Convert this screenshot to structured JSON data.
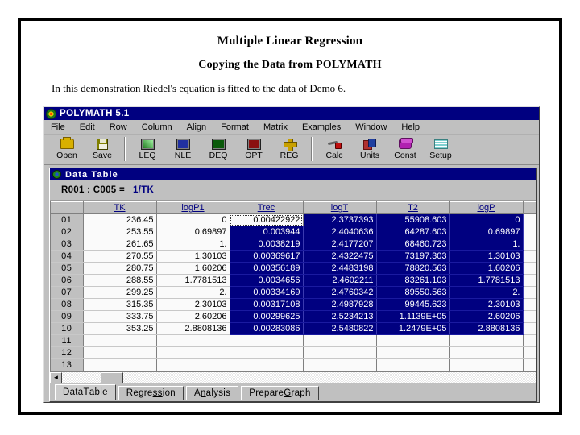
{
  "slide": {
    "heading_1": "Multiple Linear Regression",
    "heading_2": "Copying the Data from POLYMATH",
    "subtitle": "In this demonstration Riedel's equation is fitted to the data of Demo 6."
  },
  "app": {
    "title": "POLYMATH 5.1",
    "menu": [
      {
        "label": "File",
        "accel": "F"
      },
      {
        "label": "Edit",
        "accel": "E"
      },
      {
        "label": "Row",
        "accel": "R"
      },
      {
        "label": "Column",
        "accel": "C"
      },
      {
        "label": "Align",
        "accel": "A"
      },
      {
        "label": "Format",
        "accel": "a"
      },
      {
        "label": "Matrix",
        "accel": "x"
      },
      {
        "label": "Examples",
        "accel": "x"
      },
      {
        "label": "Window",
        "accel": "W"
      },
      {
        "label": "Help",
        "accel": "H"
      }
    ],
    "toolbar": [
      {
        "label": "Open",
        "icon": "folder-open-icon"
      },
      {
        "label": "Save",
        "icon": "floppy-disk-icon"
      },
      {
        "sep": true
      },
      {
        "label": "LEQ",
        "icon": "linear-equations-icon"
      },
      {
        "label": "NLE",
        "icon": "nonlinear-equations-icon"
      },
      {
        "label": "DEQ",
        "icon": "differential-equations-icon"
      },
      {
        "label": "OPT",
        "icon": "optimization-icon"
      },
      {
        "label": "REG",
        "icon": "regression-icon"
      },
      {
        "sep": true
      },
      {
        "label": "Calc",
        "icon": "calculator-icon"
      },
      {
        "label": "Units",
        "icon": "units-icon"
      },
      {
        "label": "Const",
        "icon": "constants-book-icon"
      },
      {
        "label": "Setup",
        "icon": "setup-bricks-icon"
      }
    ]
  },
  "data_table": {
    "window_title": "Data Table",
    "formula_cellref": "R001 : C005 =",
    "formula_expression": "1/TK",
    "columns": [
      "TK",
      "logP1",
      "Trec",
      "logT",
      "T2",
      "logP"
    ],
    "selected_columns": [
      "Trec",
      "logT",
      "T2",
      "logP"
    ],
    "active_cell": {
      "row": 1,
      "column": "Trec",
      "value": "0.00422922"
    },
    "rows": [
      {
        "num": "01",
        "values": [
          "236.45",
          "0",
          "0.00422922",
          "2.3737393",
          "55908.603",
          "0"
        ]
      },
      {
        "num": "02",
        "values": [
          "253.55",
          "0.69897",
          "0.003944",
          "2.4040636",
          "64287.603",
          "0.69897"
        ]
      },
      {
        "num": "03",
        "values": [
          "261.65",
          "1.",
          "0.0038219",
          "2.4177207",
          "68460.723",
          "1."
        ]
      },
      {
        "num": "04",
        "values": [
          "270.55",
          "1.30103",
          "0.00369617",
          "2.4322475",
          "73197.303",
          "1.30103"
        ]
      },
      {
        "num": "05",
        "values": [
          "280.75",
          "1.60206",
          "0.00356189",
          "2.4483198",
          "78820.563",
          "1.60206"
        ]
      },
      {
        "num": "06",
        "values": [
          "288.55",
          "1.7781513",
          "0.0034656",
          "2.4602211",
          "83261.103",
          "1.7781513"
        ]
      },
      {
        "num": "07",
        "values": [
          "299.25",
          "2.",
          "0.00334169",
          "2.4760342",
          "89550.563",
          "2."
        ]
      },
      {
        "num": "08",
        "values": [
          "315.35",
          "2.30103",
          "0.00317108",
          "2.4987928",
          "99445.623",
          "2.30103"
        ]
      },
      {
        "num": "09",
        "values": [
          "333.75",
          "2.60206",
          "0.00299625",
          "2.5234213",
          "1.1139E+05",
          "2.60206"
        ]
      },
      {
        "num": "10",
        "values": [
          "353.25",
          "2.8808136",
          "0.00283086",
          "2.5480822",
          "1.2479E+05",
          "2.8808136"
        ]
      },
      {
        "num": "11",
        "values": [
          "",
          "",
          "",
          "",
          "",
          ""
        ]
      },
      {
        "num": "12",
        "values": [
          "",
          "",
          "",
          "",
          "",
          ""
        ]
      },
      {
        "num": "13",
        "values": [
          "",
          "",
          "",
          "",
          "",
          ""
        ]
      }
    ],
    "scroll": {
      "left_arrow": "◄"
    },
    "tabs": [
      {
        "label": "Data Table",
        "accel": "T",
        "active": true
      },
      {
        "label": "Regression",
        "accel": "ss",
        "active": false
      },
      {
        "label": "Analysis",
        "accel": "n",
        "active": false
      },
      {
        "label": "Prepare Graph",
        "accel": "G",
        "active": false
      }
    ]
  },
  "colors": {
    "titlebar": "#000080",
    "selection": "#000080",
    "face": "#c0c0c0",
    "header_text": "#000080"
  }
}
